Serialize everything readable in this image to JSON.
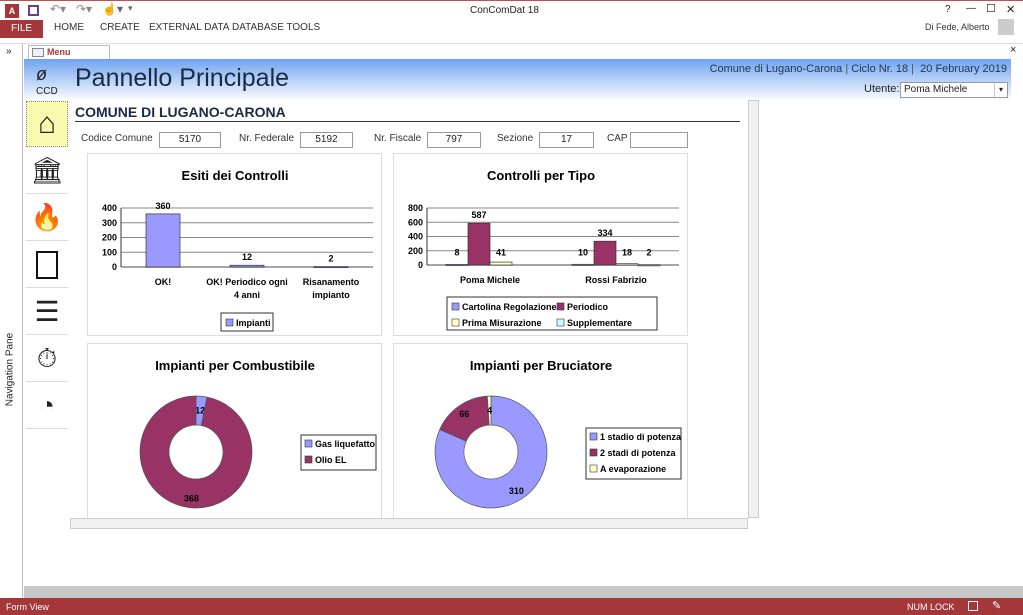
{
  "window": {
    "title": "ConComDat 18",
    "user": "Di Fede, Alberto",
    "help": "?",
    "minimize": "—",
    "maximize": "☐",
    "close": "✕"
  },
  "ribbon": {
    "file": "FILE",
    "tabs": [
      "HOME",
      "CREATE",
      "EXTERNAL DATA",
      "DATABASE TOOLS"
    ]
  },
  "nav_pane": {
    "label": "Navigation Pane",
    "toggle": "»"
  },
  "doc_tab": {
    "label": "Menu Principale",
    "close": "×"
  },
  "header": {
    "logo_text": "CCD",
    "title": "Pannello Principale",
    "comune": "Comune di Lugano-Carona",
    "ciclo": "Ciclo Nr. 18",
    "date": "20 February 2019",
    "utente_label": "Utente:",
    "utente_value": "Poma Michele"
  },
  "form": {
    "comune_title": "COMUNE DI LUGANO-CARONA",
    "fields": [
      {
        "label": "Codice Comune",
        "value": "5170"
      },
      {
        "label": "Nr. Federale",
        "value": "5192"
      },
      {
        "label": "Nr. Fiscale",
        "value": "797"
      },
      {
        "label": "Sezione",
        "value": "17"
      },
      {
        "label": "CAP",
        "value": ""
      }
    ]
  },
  "sidebar": [
    "home",
    "bank",
    "fire",
    "contacts",
    "list",
    "stopwatch",
    "reports"
  ],
  "colors": {
    "blue": "#9999ff",
    "maroon": "#993366",
    "cream": "#ffffcc",
    "cyan": "#ccffff",
    "status": "#a4373a"
  },
  "chart_data": [
    {
      "type": "bar",
      "title": "Esiti dei Controlli",
      "categories": [
        "OK!",
        "OK! Periodico ogni 4 anni",
        "Risanamento impianto"
      ],
      "series": [
        {
          "name": "Impianti",
          "values": [
            360,
            12,
            2
          ]
        }
      ],
      "ylim": [
        0,
        400
      ],
      "yticks": [
        0,
        100,
        200,
        300,
        400
      ],
      "legend": "bottom"
    },
    {
      "type": "bar",
      "title": "Controlli per Tipo",
      "categories": [
        "Poma Michele",
        "Rossi Fabrizio"
      ],
      "series": [
        {
          "name": "Cartolina Regolazione",
          "values": [
            8,
            10
          ]
        },
        {
          "name": "Periodico",
          "values": [
            587,
            334
          ]
        },
        {
          "name": "Prima Misurazione",
          "values": [
            41,
            18
          ]
        },
        {
          "name": "Supplementare",
          "values": [
            null,
            2
          ]
        }
      ],
      "ylim": [
        0,
        800
      ],
      "yticks": [
        0,
        200,
        400,
        600,
        800
      ],
      "legend": "bottom"
    },
    {
      "type": "pie",
      "donut": true,
      "title": "Impianti per Combustibile",
      "labels": [
        "Gas liquefatto",
        "Olio EL"
      ],
      "values": [
        12,
        368
      ],
      "legend": "right"
    },
    {
      "type": "pie",
      "donut": true,
      "title": "Impianti per Bruciatore",
      "labels": [
        "1 stadio di potenza",
        "2 stadi di potenza",
        "A evaporazione"
      ],
      "values": [
        310,
        66,
        4
      ],
      "legend": "right"
    }
  ],
  "status": {
    "left": "Form View",
    "num_lock": "NUM LOCK"
  }
}
